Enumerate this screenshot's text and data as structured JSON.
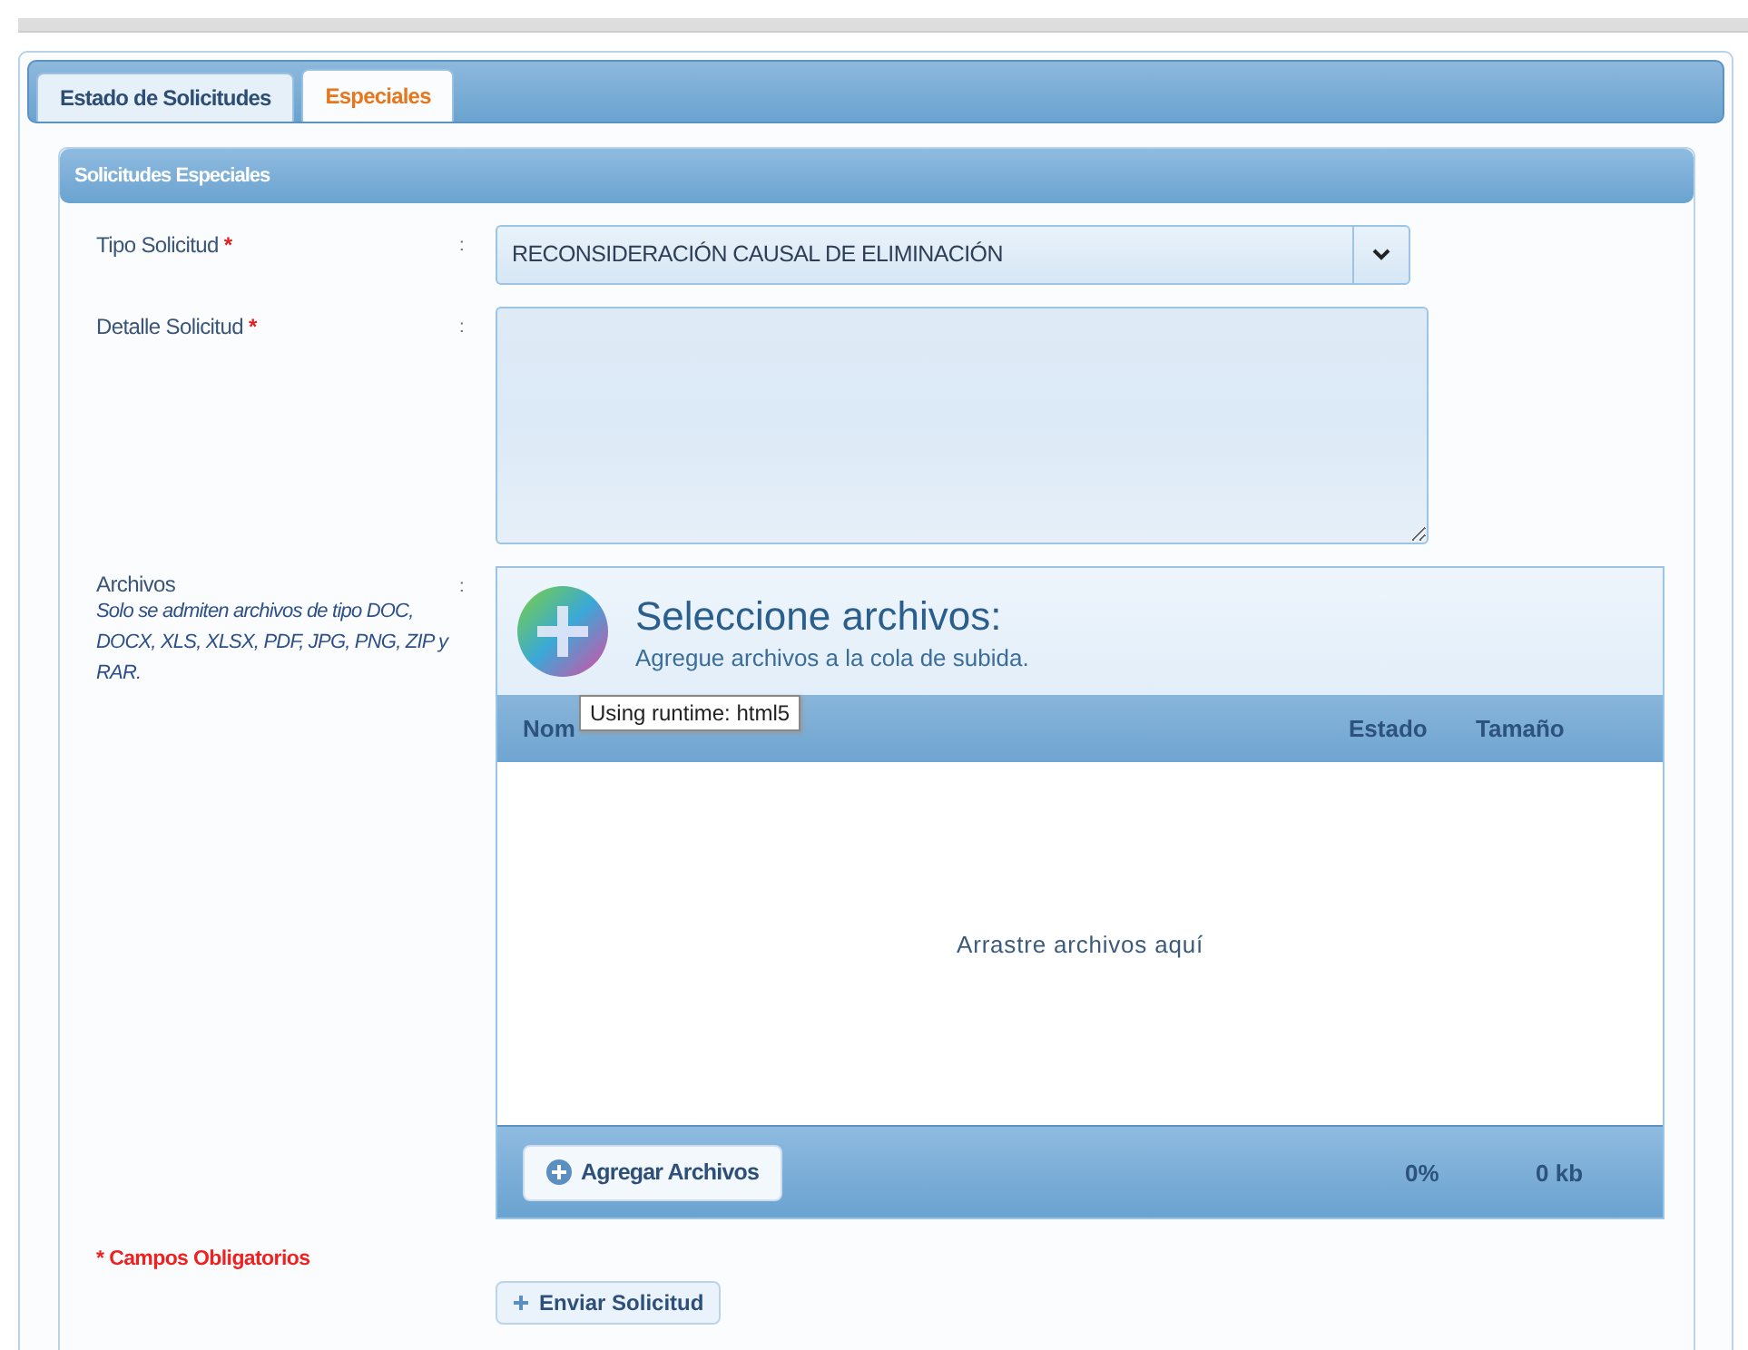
{
  "tabs": [
    {
      "label": "Estado de Solicitudes",
      "selected": false
    },
    {
      "label": "Especiales",
      "selected": true
    }
  ],
  "section_title": "Solicitudes Especiales",
  "form": {
    "tipo": {
      "label": "Tipo Solicitud",
      "required_mark": "*",
      "separator": ":",
      "value": "RECONSIDERACIÓN CAUSAL DE ELIMINACIÓN"
    },
    "detalle": {
      "label": "Detalle Solicitud",
      "required_mark": "*",
      "separator": ":"
    },
    "archivos": {
      "label": "Archivos",
      "separator": ":",
      "hint": "Solo se admiten archivos de tipo DOC, DOCX, XLS, XLSX, PDF, JPG, PNG, ZIP y RAR."
    }
  },
  "uploader": {
    "title": "Seleccione archivos:",
    "subtitle": "Agregue archivos a la cola de subida.",
    "tooltip": "Using runtime: html5",
    "columns": [
      "Nom",
      "Estado",
      "Tamaño"
    ],
    "drop_text": "Arrastre archivos aquí",
    "add_button": "Agregar Archivos",
    "percent": "0%",
    "size": "0 kb"
  },
  "required_note": "* Campos Obligatorios",
  "submit_button": "Enviar Solicitud"
}
